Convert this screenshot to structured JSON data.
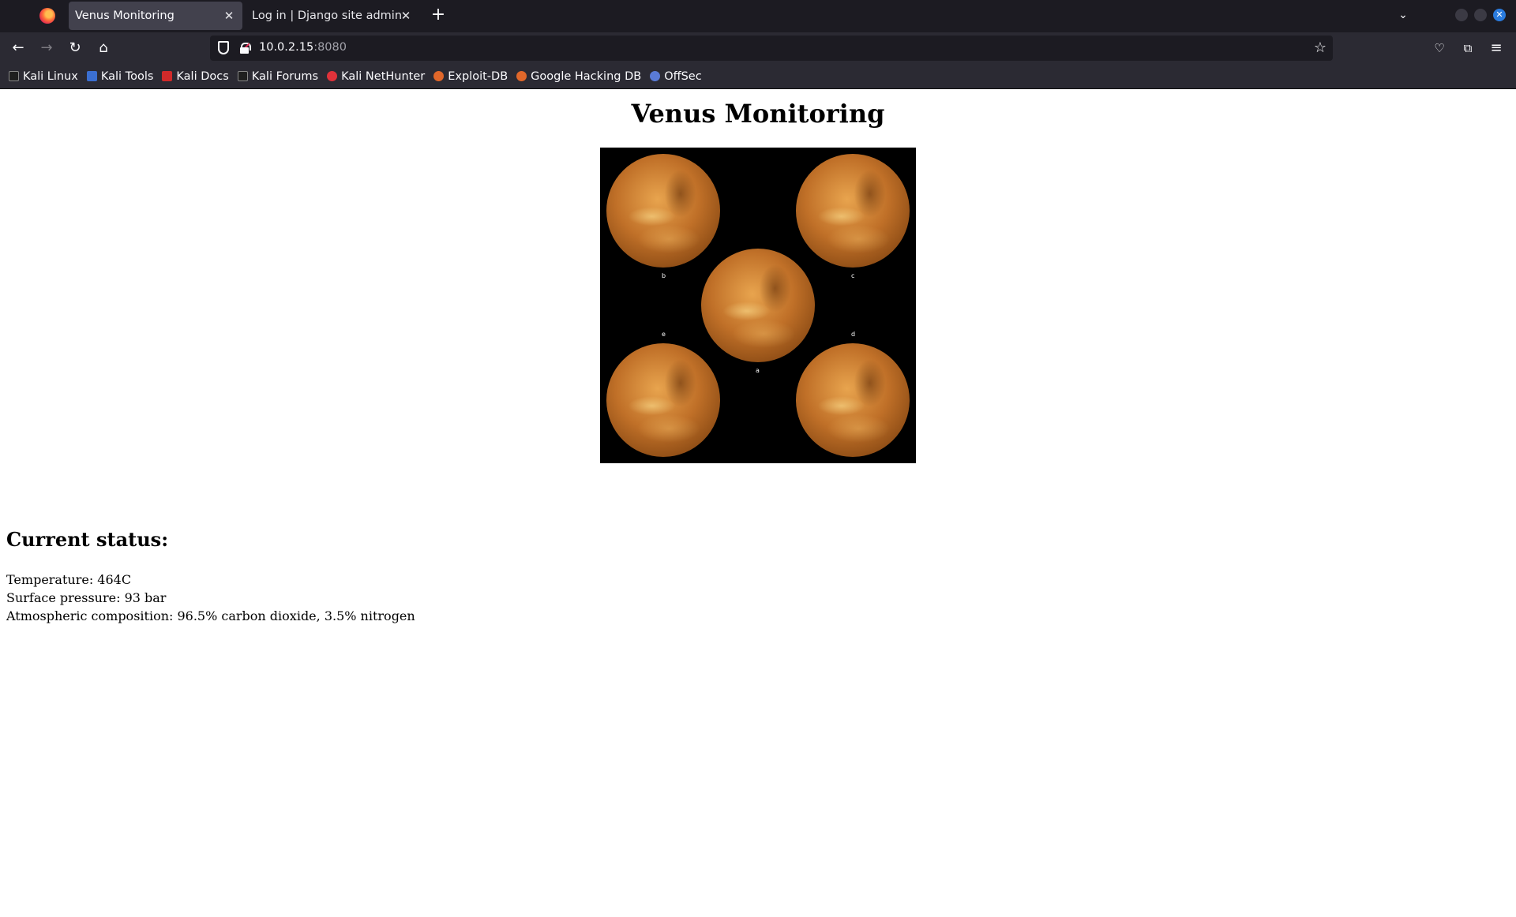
{
  "browser": {
    "tabs": [
      {
        "title": "Venus Monitoring",
        "active": true
      },
      {
        "title": "Log in | Django site admin",
        "active": false
      }
    ],
    "new_tab_label": "+",
    "url": {
      "host": "10.0.2.15",
      "port": ":8080"
    },
    "bookmarks": [
      {
        "label": "Kali Linux",
        "icon": "kali-dragon-icon",
        "color": "#1f1f1f"
      },
      {
        "label": "Kali Tools",
        "icon": "kali-tools-icon",
        "color": "#3b6fd1"
      },
      {
        "label": "Kali Docs",
        "icon": "kali-docs-icon",
        "color": "#d12a2a"
      },
      {
        "label": "Kali Forums",
        "icon": "kali-forums-icon",
        "color": "#1f1f1f"
      },
      {
        "label": "Kali NetHunter",
        "icon": "nethunter-icon",
        "color": "#e0323a"
      },
      {
        "label": "Exploit-DB",
        "icon": "exploit-db-icon",
        "color": "#e0672a"
      },
      {
        "label": "Google Hacking DB",
        "icon": "ghdb-icon",
        "color": "#e0672a"
      },
      {
        "label": "OffSec",
        "icon": "offsec-icon",
        "color": "#5a7bd6"
      }
    ]
  },
  "page": {
    "title": "Venus Monitoring",
    "image_labels": [
      "b",
      "c",
      "a",
      "e",
      "d"
    ],
    "status_heading": "Current status:",
    "status_lines": [
      "Temperature: 464C",
      "Surface pressure: 93 bar",
      "Atmospheric composition: 96.5% carbon dioxide, 3.5% nitrogen"
    ]
  }
}
